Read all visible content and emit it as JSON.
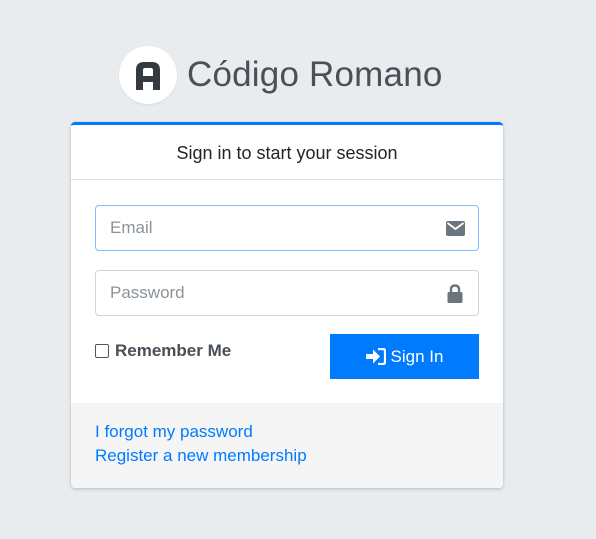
{
  "brand": {
    "name": "Código Romano",
    "logo_letter_icon": "letter-a-logo"
  },
  "card": {
    "header": "Sign in to start your session",
    "email": {
      "placeholder": "Email",
      "value": "",
      "icon": "envelope-icon"
    },
    "password": {
      "placeholder": "Password",
      "value": "",
      "icon": "lock-icon"
    },
    "remember": {
      "label": "Remember Me",
      "checked": false
    },
    "signin": {
      "label": "Sign In",
      "icon": "sign-in-icon"
    },
    "footer": {
      "forgot": "I forgot my password",
      "register": "Register a new membership"
    }
  },
  "colors": {
    "accent": "#007bff",
    "background": "#e9ecef"
  }
}
